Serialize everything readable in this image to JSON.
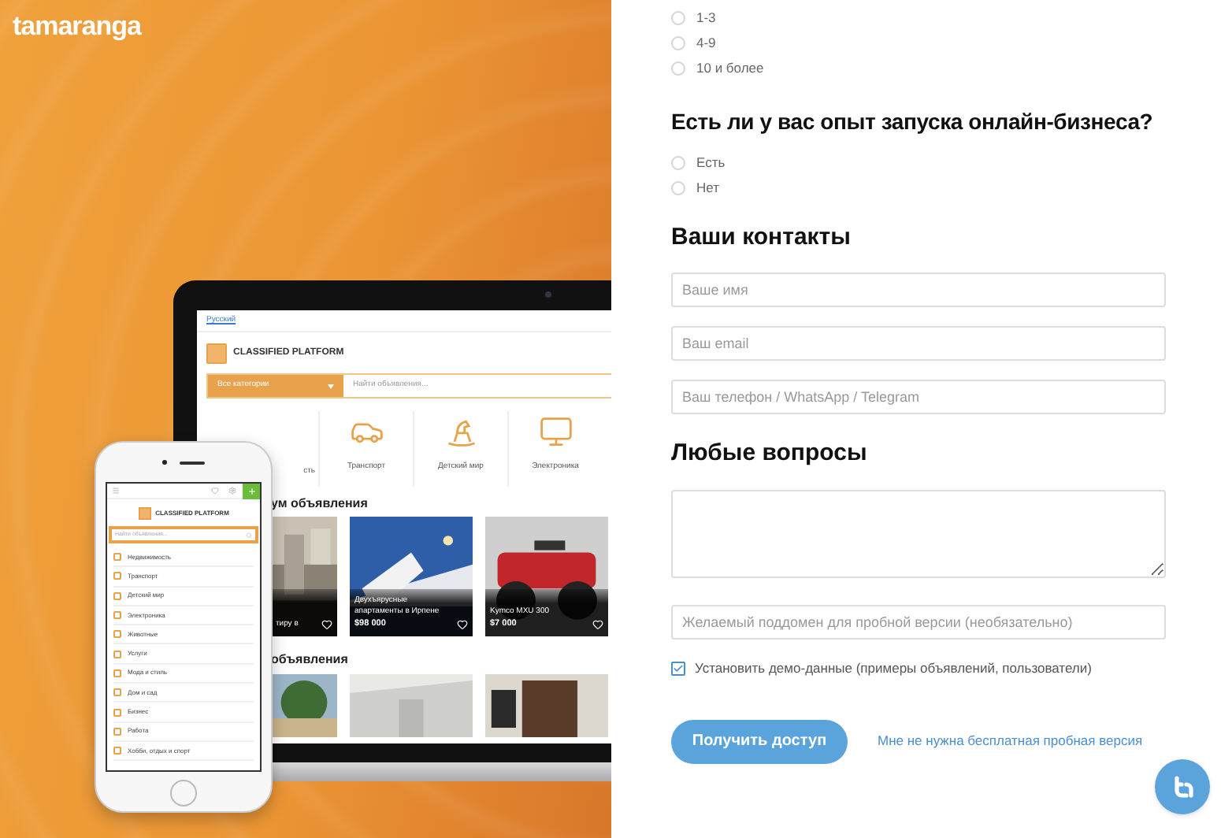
{
  "brand": {
    "logo": "tamaranga"
  },
  "laptop_screen": {
    "language": "Русский",
    "site_title": "CLASSIFIED PLATFORM",
    "category_select": "Все категории",
    "search": {
      "placeholder": "Найти объявления..."
    },
    "categories": [
      {
        "label": "сть"
      },
      {
        "kind": "car",
        "label": "Транспорт"
      },
      {
        "kind": "horse",
        "label": "Детский мир"
      },
      {
        "kind": "monitor",
        "label": "Электроника"
      }
    ],
    "section_1": "ум объявления",
    "listings": [
      {
        "kind": "room",
        "title": "тиру в"
      },
      {
        "kind": "apartment",
        "title": "Двухъярусные апартаменты в Ирпене",
        "price": "$98 000"
      },
      {
        "kind": "quad",
        "title": "Kymco MXU 300",
        "price": "$7 000"
      }
    ],
    "section_2": "объявления"
  },
  "phone_screen": {
    "site_title": "CLASSIFIED PLATFORM",
    "search": {
      "placeholder": "Найти объявления..."
    },
    "categories": [
      "Недвижимость",
      "Транспорт",
      "Детский мир",
      "Электроника",
      "Животные",
      "Услуги",
      "Мода и стиль",
      "Дом и сад",
      "Бизнес",
      "Работа",
      "Хобби, отдых и спорт"
    ]
  },
  "form": {
    "experience_options": [
      {
        "label": "1-3",
        "selected": false
      },
      {
        "label": "4-9",
        "selected": false
      },
      {
        "label": "10 и более",
        "selected": false
      }
    ],
    "business_question": "Есть ли у вас опыт запуска онлайн-бизнеса?",
    "business_options": [
      {
        "label": "Есть",
        "selected": false
      },
      {
        "label": "Нет",
        "selected": false
      }
    ],
    "contacts_heading": "Ваши контакты",
    "contact_fields": [
      {
        "placeholder": "Ваше имя"
      },
      {
        "placeholder": "Ваш email"
      },
      {
        "placeholder": "Ваш телефон / WhatsApp / Telegram"
      }
    ],
    "questions_heading": "Любые вопросы",
    "subdomain_field": {
      "placeholder": "Желаемый поддомен для пробной версии (необязательно)"
    },
    "demo_data": {
      "label": "Установить демо-данные (примеры объявлений, пользователи)",
      "checked": true
    },
    "submit_button": "Получить доступ",
    "skip_link": "Мне не нужна бесплатная пробная версия"
  }
}
